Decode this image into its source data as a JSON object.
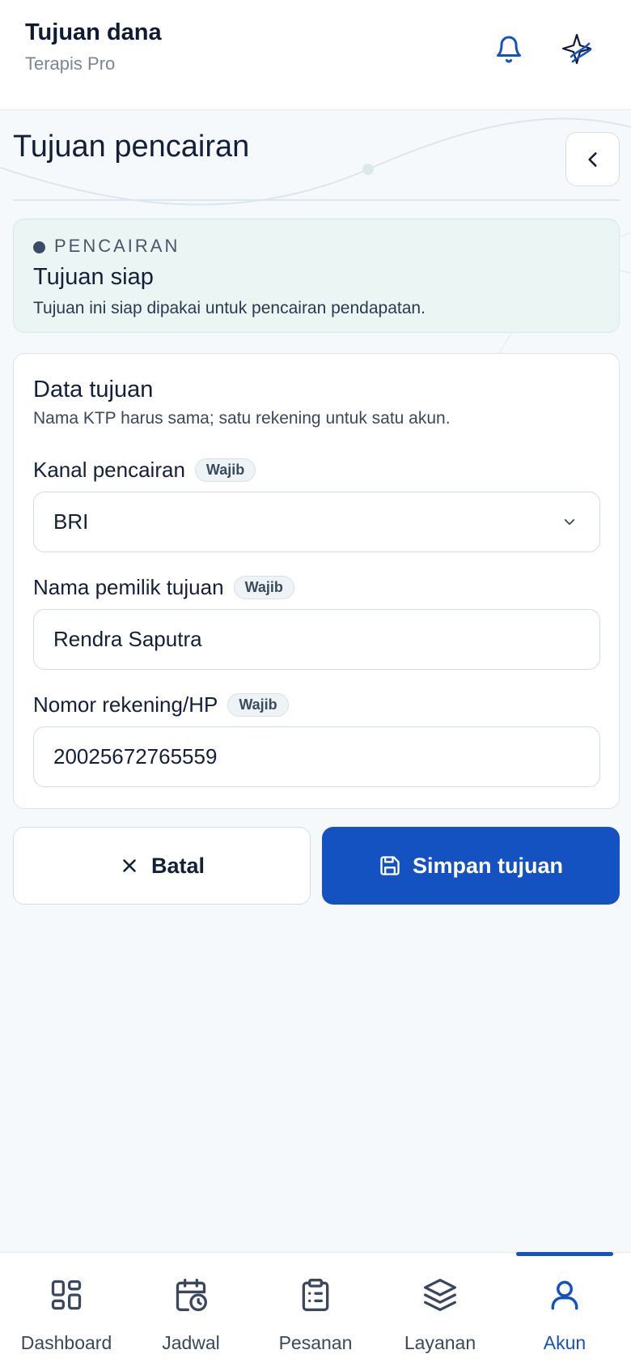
{
  "header": {
    "title": "Tujuan dana",
    "subtitle": "Terapis Pro",
    "bell_icon": "bell-icon",
    "logo_icon": "brand-logo-icon"
  },
  "page": {
    "title": "Tujuan pencairan",
    "back_icon": "chevron-left-icon"
  },
  "status": {
    "eyebrow": "PENCAIRAN",
    "title": "Tujuan siap",
    "description": "Tujuan ini siap dipakai untuk pencairan pendapatan."
  },
  "form": {
    "title": "Data tujuan",
    "subtitle": "Nama KTP harus sama; satu rekening untuk satu akun.",
    "required_badge": "Wajib",
    "channel": {
      "label": "Kanal pencairan",
      "value": "BRI"
    },
    "owner": {
      "label": "Nama pemilik tujuan",
      "value": "Rendra Saputra"
    },
    "number": {
      "label": "Nomor rekening/HP",
      "value": "20025672765559"
    }
  },
  "actions": {
    "cancel_label": "Batal",
    "save_label": "Simpan tujuan"
  },
  "nav": {
    "active": "Akun",
    "items": [
      {
        "label": "Dashboard",
        "icon": "dashboard-icon"
      },
      {
        "label": "Jadwal",
        "icon": "calendar-clock-icon"
      },
      {
        "label": "Pesanan",
        "icon": "clipboard-list-icon"
      },
      {
        "label": "Layanan",
        "icon": "layers-icon"
      },
      {
        "label": "Akun",
        "icon": "user-icon"
      }
    ]
  },
  "colors": {
    "primary": "#1452c2",
    "status_bg": "#ebf5f3",
    "page_bg": "#f6f9fc",
    "text": "#14203a"
  }
}
